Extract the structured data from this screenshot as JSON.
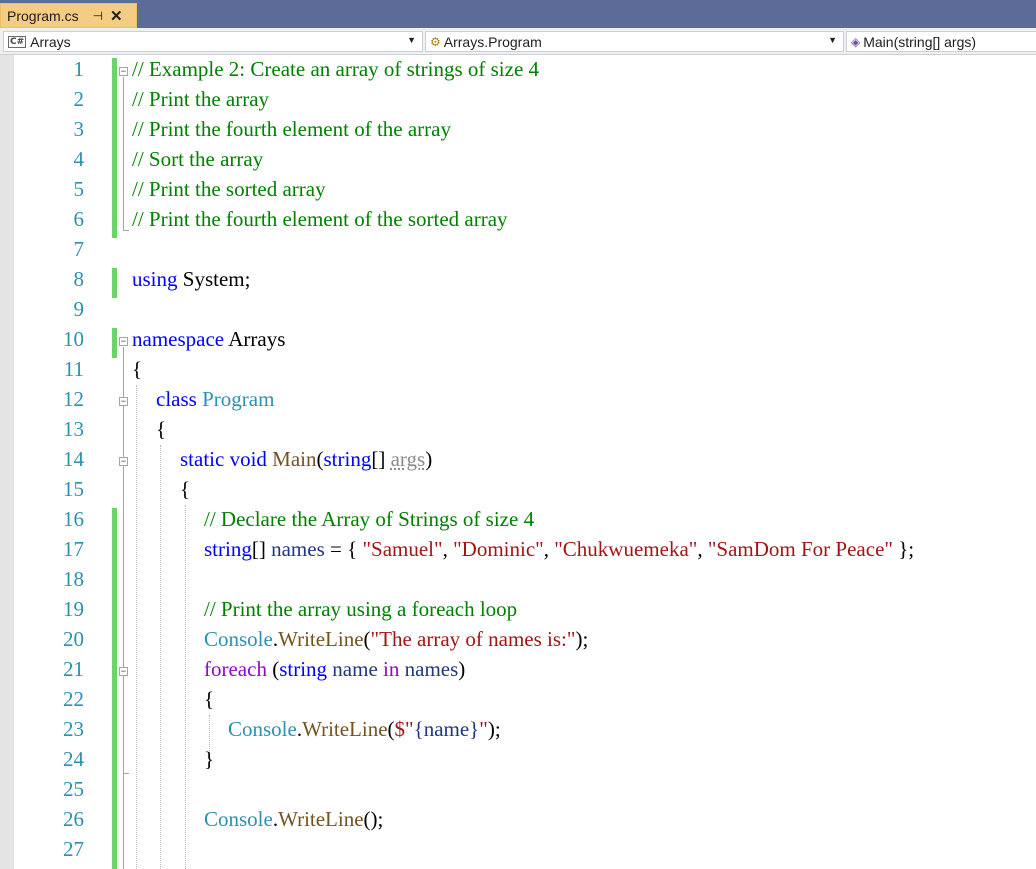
{
  "tab": {
    "title": "Program.cs",
    "pin_icon": "pin-icon",
    "close_icon": "close-icon"
  },
  "nav": {
    "project": "Arrays",
    "class": "Arrays.Program",
    "member": "Main(string[] args)"
  },
  "line_numbers": [
    "1",
    "2",
    "3",
    "4",
    "5",
    "6",
    "7",
    "8",
    "9",
    "10",
    "11",
    "12",
    "13",
    "14",
    "15",
    "16",
    "17",
    "18",
    "19",
    "20",
    "21",
    "22",
    "23",
    "24",
    "25",
    "26",
    "27"
  ],
  "code": {
    "l1": "// Example 2: Create an array of strings of size 4",
    "l2": "// Print the array",
    "l3": "// Print the fourth element of the array",
    "l4": "// Sort the array",
    "l5": "// Print the sorted array",
    "l6": "// Print the fourth element of the sorted array",
    "l8_kw": "using",
    "l8_rest": " System;",
    "l10_kw": "namespace",
    "l10_rest": " Arrays",
    "l11": "{",
    "l12_kw": "class",
    "l12_type": "Program",
    "l13": "{",
    "l14_kw1": "static",
    "l14_kw2": "void",
    "l14_meth": "Main",
    "l14_p1": "(",
    "l14_kw3": "string",
    "l14_p2": "[] ",
    "l14_param": "args",
    "l14_p3": ")",
    "l15": "{",
    "l16": "// Declare the Array of Strings of size 4",
    "l17_kw": "string",
    "l17_p1": "[] ",
    "l17_var": "names",
    "l17_p2": " = { ",
    "l17_s1": "\"Samuel\"",
    "l17_c1": ", ",
    "l17_s2": "\"Dominic\"",
    "l17_c2": ", ",
    "l17_s3": "\"Chukwuemeka\"",
    "l17_c3": ", ",
    "l17_s4": "\"SamDom For Peace\"",
    "l17_end": " };",
    "l19": "// Print the array using a foreach loop",
    "l20_type": "Console",
    "l20_dot": ".",
    "l20_meth": "WriteLine",
    "l20_p1": "(",
    "l20_str": "\"The array of names is:\"",
    "l20_end": ");",
    "l21_ctl": "foreach",
    "l21_p1": " (",
    "l21_kw": "string",
    "l21_sp": " ",
    "l21_var": "name",
    "l21_in": " in ",
    "l21_var2": "names",
    "l21_end": ")",
    "l22": "{",
    "l23_type": "Console",
    "l23_dot": ".",
    "l23_meth": "WriteLine",
    "l23_p1": "(",
    "l23_s1": "$\"",
    "l23_interp": "{name}",
    "l23_s2": "\"",
    "l23_end": ");",
    "l24": "}",
    "l26_type": "Console",
    "l26_dot": ".",
    "l26_meth": "WriteLine",
    "l26_end": "();"
  },
  "colors": {
    "tabbar": "#5d6b99",
    "active_tab": "#f5cc84",
    "comment": "#008000",
    "keyword": "#0000ff",
    "type": "#2b91af",
    "method": "#74531f",
    "string": "#a31515",
    "control": "#8f08c4",
    "variable": "#1f377f",
    "line_number": "#2b91af",
    "change_bar": "#6ad46a"
  }
}
